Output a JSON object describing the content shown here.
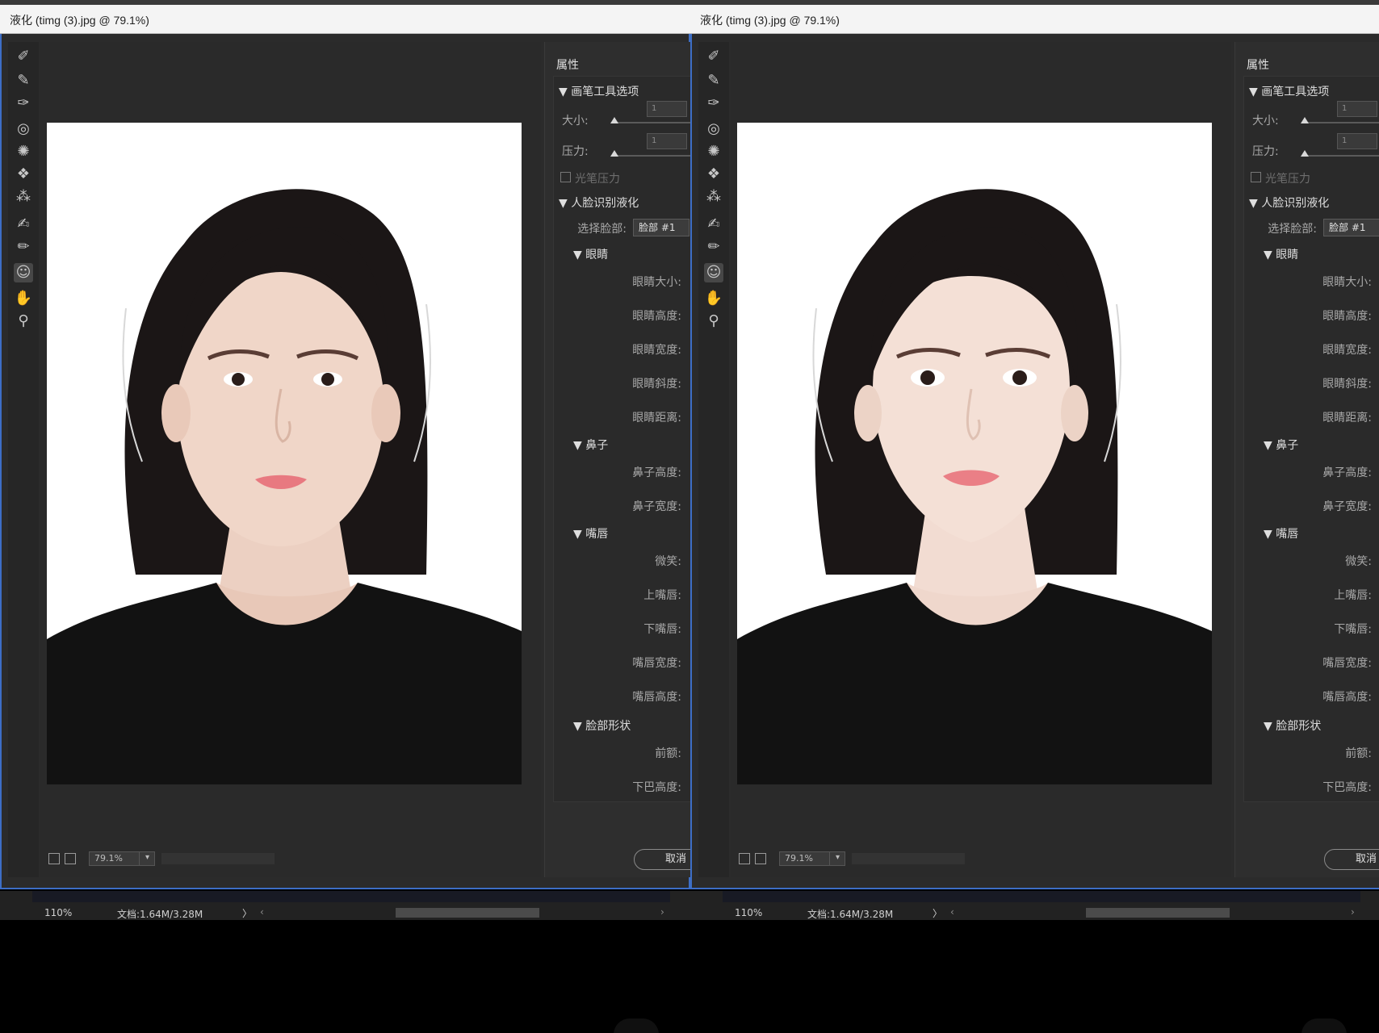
{
  "colors": {
    "accent_border": "#3d6ec6",
    "dialog_bg": "#2b2b2b",
    "titlebar_bg": "#f4f4f4"
  },
  "tools": [
    {
      "name": "forward-warp-tool-icon",
      "glyph": "✐"
    },
    {
      "name": "reconstruct-tool-icon",
      "glyph": "✎"
    },
    {
      "name": "smooth-tool-icon",
      "glyph": "✑"
    },
    {
      "name": "twirl-tool-icon",
      "glyph": "◎"
    },
    {
      "name": "pucker-tool-icon",
      "glyph": "✺"
    },
    {
      "name": "bloat-tool-icon",
      "glyph": "❖"
    },
    {
      "name": "push-left-tool-icon",
      "glyph": "⁂"
    },
    {
      "name": "freeze-mask-tool-icon",
      "glyph": "✍"
    },
    {
      "name": "thaw-mask-tool-icon",
      "glyph": "✏"
    },
    {
      "name": "face-tool-icon",
      "glyph": "☺"
    },
    {
      "name": "hand-tool-icon",
      "glyph": "✋"
    },
    {
      "name": "zoom-tool-icon",
      "glyph": "⚲"
    }
  ],
  "panels": [
    {
      "title": "液化 (timg (3).jpg @ 79.1%)",
      "properties": {
        "heading": "属性",
        "brush_section": "▼ 画笔工具选项",
        "size_label": "大小:",
        "size_value": "1",
        "pressure_label": "压力:",
        "pressure_value": "1",
        "stylus_label": "光笔压力",
        "face_section": "▼ 人脸识别液化",
        "select_face_label": "选择脸部:",
        "select_face_value": "脸部 #1",
        "eyes_section": "▼ 眼睛",
        "eye_labels": [
          "眼睛大小:",
          "眼睛高度:",
          "眼睛宽度:",
          "眼睛斜度:",
          "眼睛距离:"
        ],
        "nose_section": "▼ 鼻子",
        "nose_labels": [
          "鼻子高度:",
          "鼻子宽度:"
        ],
        "mouth_section": "▼ 嘴唇",
        "mouth_labels": [
          "微笑:",
          "上嘴唇:",
          "下嘴唇:",
          "嘴唇宽度:",
          "嘴唇高度:"
        ],
        "faceshape_section": "▼ 脸部形状",
        "faceshape_labels": [
          "前额:",
          "下巴高度:"
        ],
        "cancel": "取消"
      },
      "zoom": "79.1%",
      "status_zoom": "110%",
      "status_doc": "文档:1.64M/3.28M"
    },
    {
      "title": "液化 (timg (3).jpg @ 79.1%)",
      "properties": {
        "heading": "属性",
        "brush_section": "▼ 画笔工具选项",
        "size_label": "大小:",
        "size_value": "1",
        "pressure_label": "压力:",
        "pressure_value": "1",
        "stylus_label": "光笔压力",
        "face_section": "▼ 人脸识别液化",
        "select_face_label": "选择脸部:",
        "select_face_value": "脸部 #1",
        "eyes_section": "▼ 眼睛",
        "eye_labels": [
          "眼睛大小:",
          "眼睛高度:",
          "眼睛宽度:",
          "眼睛斜度:",
          "眼睛距离:"
        ],
        "nose_section": "▼ 鼻子",
        "nose_labels": [
          "鼻子高度:",
          "鼻子宽度:"
        ],
        "mouth_section": "▼ 嘴唇",
        "mouth_labels": [
          "微笑:",
          "上嘴唇:",
          "下嘴唇:",
          "嘴唇宽度:",
          "嘴唇高度:"
        ],
        "faceshape_section": "▼ 脸部形状",
        "faceshape_labels": [
          "前额:",
          "下巴高度:"
        ],
        "cancel": "取消"
      },
      "zoom": "79.1%",
      "status_zoom": "110%",
      "status_doc": "文档:1.64M/3.28M"
    }
  ]
}
